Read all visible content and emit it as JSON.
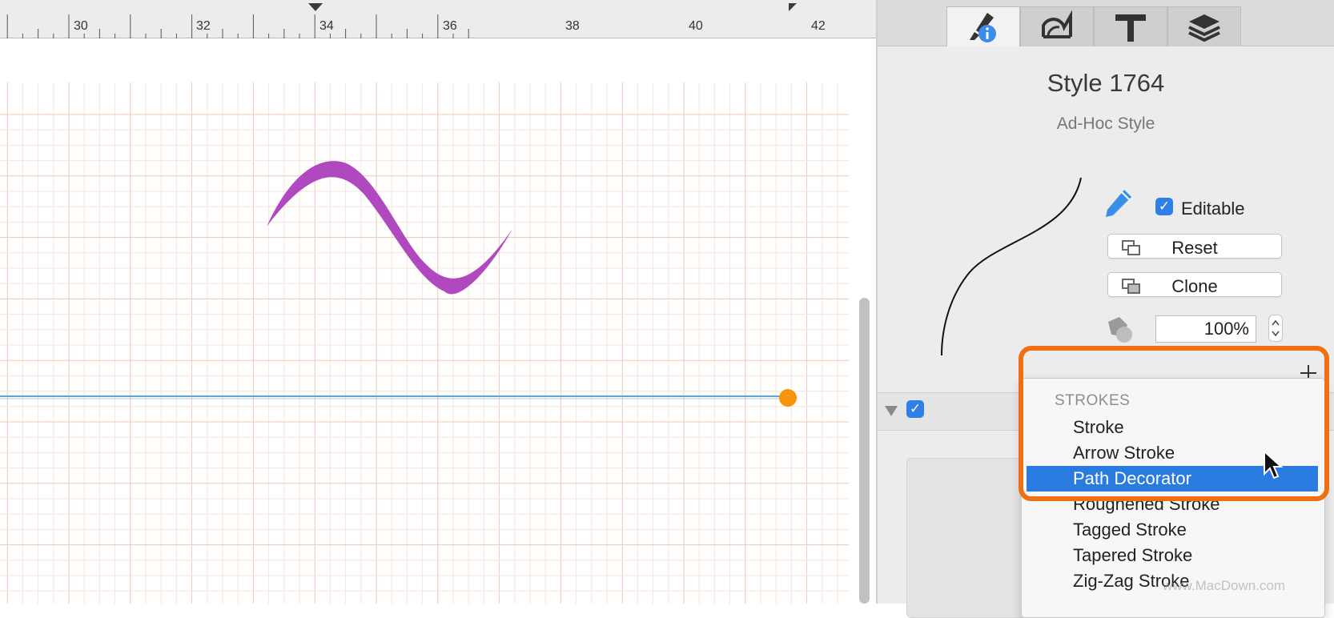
{
  "ruler": {
    "labels": [
      "30",
      "32",
      "34",
      "36",
      "38",
      "40",
      "42"
    ]
  },
  "inspector": {
    "tabs": [
      "style-inspector-tab",
      "geometry-tab",
      "text-tab",
      "layers-tab"
    ],
    "style_title": "Style 1764",
    "style_subtitle": "Ad-Hoc Style",
    "editable_label": "Editable",
    "editable_checked": true,
    "reset_label": "Reset",
    "clone_label": "Clone",
    "opacity_value": "100%"
  },
  "menu": {
    "header": "STROKES",
    "items": [
      {
        "label": "Stroke",
        "selected": false
      },
      {
        "label": "Arrow Stroke",
        "selected": false
      },
      {
        "label": "Path Decorator",
        "selected": true
      },
      {
        "label": "Roughened Stroke",
        "selected": false
      },
      {
        "label": "Tagged Stroke",
        "selected": false
      },
      {
        "label": "Tapered Stroke",
        "selected": false
      },
      {
        "label": "Zig-Zag Stroke",
        "selected": false
      }
    ]
  },
  "watermark": "www.MacDown.com",
  "colors": {
    "accent": "#2a7be0",
    "curve": "#b048c0",
    "highlight": "#f06f12",
    "handle": "#f7930c",
    "guide": "#5aa7d8",
    "grid_major": "#ecc8b4",
    "grid_minor": "#f7e4d8"
  }
}
